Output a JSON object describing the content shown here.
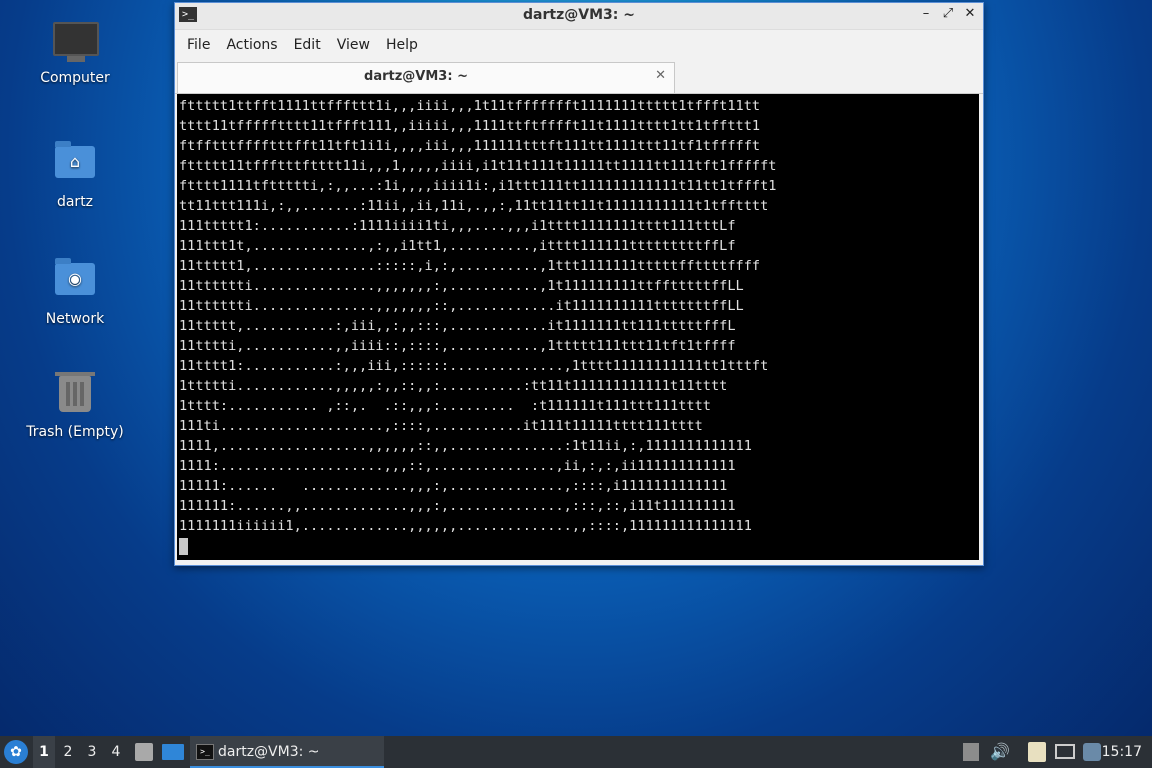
{
  "desktop": {
    "icons": [
      {
        "label": "Computer",
        "icon": "computer-icon"
      },
      {
        "label": "dartz",
        "icon": "home-folder-icon"
      },
      {
        "label": "Network",
        "icon": "network-folder-icon"
      },
      {
        "label": "Trash (Empty)",
        "icon": "trash-icon"
      }
    ]
  },
  "window": {
    "title": "dartz@VM3: ~",
    "controls": {
      "minimize": "–",
      "maximize": "⤢",
      "close": "✕"
    },
    "menu": [
      "File",
      "Actions",
      "Edit",
      "View",
      "Help"
    ],
    "tab": {
      "label": "dartz@VM3: ~",
      "close": "✕"
    },
    "terminal_lines": [
      "fttttt1ttfft1111ttfffttt1i,,,iiii,,,1t11tffffffft1111111ttttt1tffft11tt",
      "tttt11tffffftttt11tffft111,,iiiii,,,1111ttftfffft11t1111tttt1tt1tffttt1",
      "ftfftttfffftttfft11tft1i1i,,,,iii,,,111111tttft111tt1111ttt11tf1tffffft",
      "fttttt11tffftttftttt11i,,,1,,,,,iiii,i1t11t111t11111tt1111tt111tft1ffffft",
      "ftttt1111tfttttti,:,,...:1i,,,,iiii1i:,i1ttt111tt111111111111t11tt1tffft1",
      "tt11ttt111i,:,,.......:11ii,,ii,11i,.,,:,11tt11tt11t11111111111t1tfftttt",
      "111ttttt1:...........:1111iiii1ti,,,....,,,i1tttt1111111tttt111tttLf",
      "111ttt1t,..............,:,,i1tt1,..........,itttt111111tttttttttffLf",
      "11ttttt1,...............:::::,i,:,..........,1ttt1111111tttttffttttffff",
      "11tttttti...............,,,,,,,:,...........,1t111111111ttfftttttffLL",
      "11tttttti...............,,,,,,,::,............it1111111111tttttttffLL",
      "11ttttt,...........:,iii,,:,,:::,............it1111111tt111tttttfffL",
      "11tttti,...........,,iiii::,::::,...........,1ttttt111ttt11tft1tffff",
      "11tttt1:...........:,,,iii,::::::..............,1tttt11111111111tt1tttft",
      "1ttttti............,,,,,:,,::,,:..........:tt11t111111111111t11tttt",
      "1tttt:........... ,::,.  .::,,,:.........  :t111111t111ttt111tttt",
      "111ti....................,::::,...........it111t11111tttt111tttt",
      "1111,..................,,,,,,::,,..............:1t11ii,:,1111111111111",
      "1111:....................,,,::,...............,ii,:,:,ii111111111111",
      "11111:......   .............,,,:,..............,::::,i1111111111111",
      "111111:......,,.............,,,:,..............,:::,::,i11t111111111",
      "1111111iiiiii1,.............,,,,,,..............,,::::,111111111111111"
    ]
  },
  "taskbar": {
    "workspaces": [
      "1",
      "2",
      "3",
      "4"
    ],
    "active_workspace": "1",
    "window_button": "dartz@VM3: ~",
    "clock": "15:17"
  }
}
